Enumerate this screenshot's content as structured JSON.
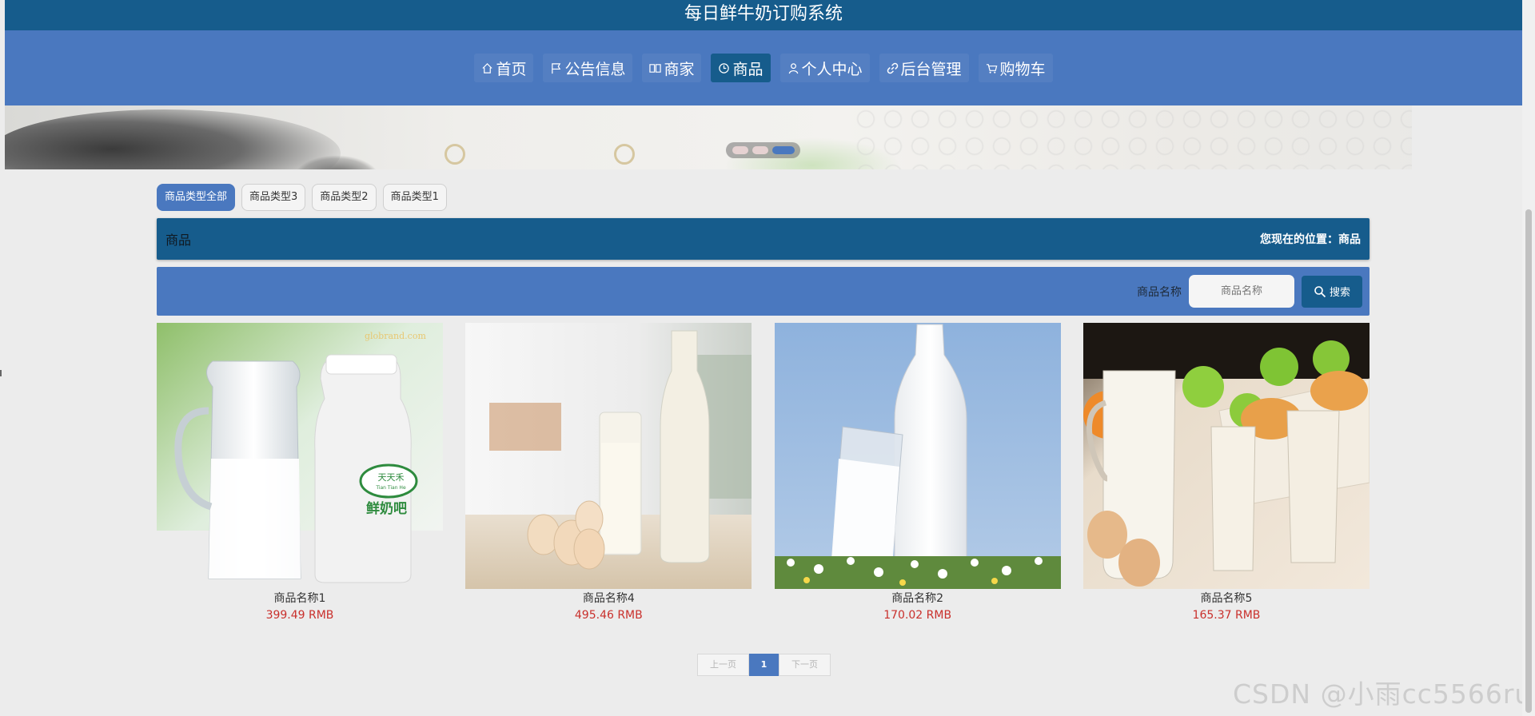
{
  "header": {
    "title": "每日鲜牛奶订购系统"
  },
  "nav": {
    "items": [
      {
        "label": "首页",
        "icon": "home-icon",
        "active": false
      },
      {
        "label": "公告信息",
        "icon": "flag-icon",
        "active": false
      },
      {
        "label": "商家",
        "icon": "book-icon",
        "active": false
      },
      {
        "label": "商品",
        "icon": "clock-icon",
        "active": true
      },
      {
        "label": "个人中心",
        "icon": "user-icon",
        "active": false
      },
      {
        "label": "后台管理",
        "icon": "link-icon",
        "active": false
      },
      {
        "label": "购物车",
        "icon": "cart-icon",
        "active": false
      }
    ]
  },
  "carousel": {
    "slide_count": 3,
    "active_index": 2
  },
  "categories": [
    {
      "label": "商品类型全部",
      "active": true
    },
    {
      "label": "商品类型3",
      "active": false
    },
    {
      "label": "商品类型2",
      "active": false
    },
    {
      "label": "商品类型1",
      "active": false
    }
  ],
  "titlebar": {
    "title": "商品",
    "location": "您现在的位置：商品"
  },
  "search": {
    "label": "商品名称",
    "placeholder": "商品名称",
    "button_label": "搜索"
  },
  "products": [
    {
      "name": "商品名称1",
      "price": "399.49 RMB",
      "image_watermark": "globrand.com",
      "bottle_label": "天天禾",
      "bottle_label_en": "Tian Tian He",
      "bottle_text": "鲜奶吧"
    },
    {
      "name": "商品名称4",
      "price": "495.46 RMB"
    },
    {
      "name": "商品名称2",
      "price": "170.02 RMB"
    },
    {
      "name": "商品名称5",
      "price": "165.37 RMB"
    }
  ],
  "pagination": {
    "prev_label": "上一页",
    "current": "1",
    "next_label": "下一页"
  },
  "watermark": "CSDN @小雨cc5566ru",
  "colors": {
    "dark_blue": "#165c8c",
    "nav_blue": "#4a78bf",
    "price_red": "#c9302c"
  }
}
